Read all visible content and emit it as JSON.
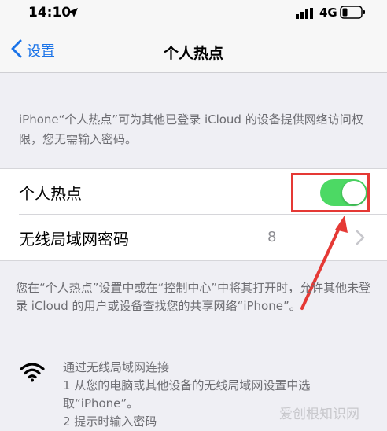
{
  "status_bar": {
    "time": "14:10",
    "network": "4G"
  },
  "nav": {
    "back_label": "设置",
    "title": "个人热点"
  },
  "description_top": "iPhone“个人热点”可为其他已登录 iCloud 的设备提供网络访问权限，您无需输入密码。",
  "cells": {
    "hotspot": {
      "label": "个人热点",
      "enabled": true
    },
    "wifi_password": {
      "label": "无线局域网密码",
      "value_visible": "8"
    }
  },
  "description_middle": "您在“个人热点”设置中或在“控制中心”中将其打开时，允许其他未登录 iCloud 的用户或设备查找您的共享网络“iPhone”。",
  "wifi_section": {
    "title": "通过无线局域网连接",
    "step1": "1 从您的电脑或其他设备的无线局域网设置中选取“iPhone”。",
    "step2_partial": "2 提示时输入密码"
  },
  "watermark": "爱创根知识网",
  "colors": {
    "accent_blue": "#1a73e8",
    "toggle_green": "#4cd964",
    "annotation_red": "#e53935",
    "background": "#efeff4"
  },
  "icons": {
    "location": "location-arrow-icon",
    "signal": "signal-bars-icon",
    "battery": "battery-icon",
    "back": "chevron-left-icon",
    "disclosure": "chevron-right-icon",
    "wifi": "wifi-icon"
  }
}
